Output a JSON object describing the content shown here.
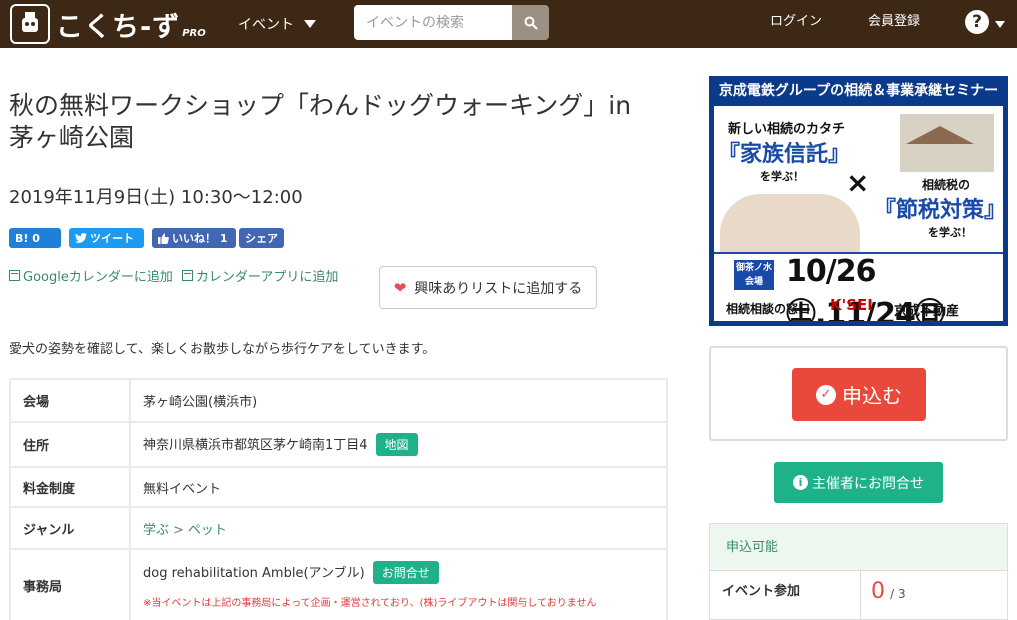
{
  "header": {
    "logo_text": "こくち-ず",
    "logo_suffix": "PRO",
    "event_menu": "イベント",
    "search_placeholder": "イベントの検索",
    "login": "ログイン",
    "register": "会員登録",
    "help": "?"
  },
  "event": {
    "title": "秋の無料ワークショップ「わんドッグウォーキング」in 茅ヶ崎公園",
    "datetime": "2019年11月9日(土) 10:30〜12:00",
    "description": "愛犬の姿勢を確認して、楽しくお散歩しながら歩行ケアをしていきます。"
  },
  "share": {
    "hatena": "B! 0",
    "tweet": "ツイート",
    "like": "いいね！ 1",
    "fb_share": "シェア"
  },
  "calendar": {
    "google": "Googleカレンダーに追加",
    "app": "カレンダーアプリに追加"
  },
  "wishlist_button": "興味ありリストに追加する",
  "details": {
    "venue_label": "会場",
    "venue_value": "茅ヶ崎公園(横浜市)",
    "address_label": "住所",
    "address_value": "神奈川県横浜市都筑区茅ケ崎南1丁目4",
    "map_tag": "地図",
    "fee_label": "料金制度",
    "fee_value": "無料イベント",
    "genre_label": "ジャンル",
    "genre_parent": "学ぶ",
    "genre_sep": ">",
    "genre_child": "ペット",
    "office_label": "事務局",
    "office_value": "dog rehabilitation Amble(アンブル)",
    "inquiry_tag": "お問合せ",
    "notice": "※当イベントは上記の事務局によって企画・運営されており、(株)ライブアウトは関与しておりません"
  },
  "banner": {
    "top": "京成電鉄グループの相続＆事業承継セミナー",
    "line1": "新しい相続のカタチ",
    "big1": "『家族信託』",
    "small1": "を学ぶ！",
    "x": "×",
    "line2": "相続税の",
    "big2": "『節税対策』",
    "small2": "を学ぶ！",
    "venue": "御茶ノ水 会場",
    "dates": "10/26㊏,11/24㊐",
    "foot_left": "相続相談の窓口",
    "foot_mid": "K'SEI",
    "foot_right": "京成不動産"
  },
  "sidebar": {
    "apply": "申込む",
    "contact": "主催者にお問合せ",
    "status": "申込可能",
    "participants_label": "イベント参加",
    "count": "0",
    "capacity": "/ 3"
  },
  "colors": {
    "header_bg": "#3c2814",
    "accent_green": "#1fb18a",
    "apply_red": "#e9493b"
  }
}
